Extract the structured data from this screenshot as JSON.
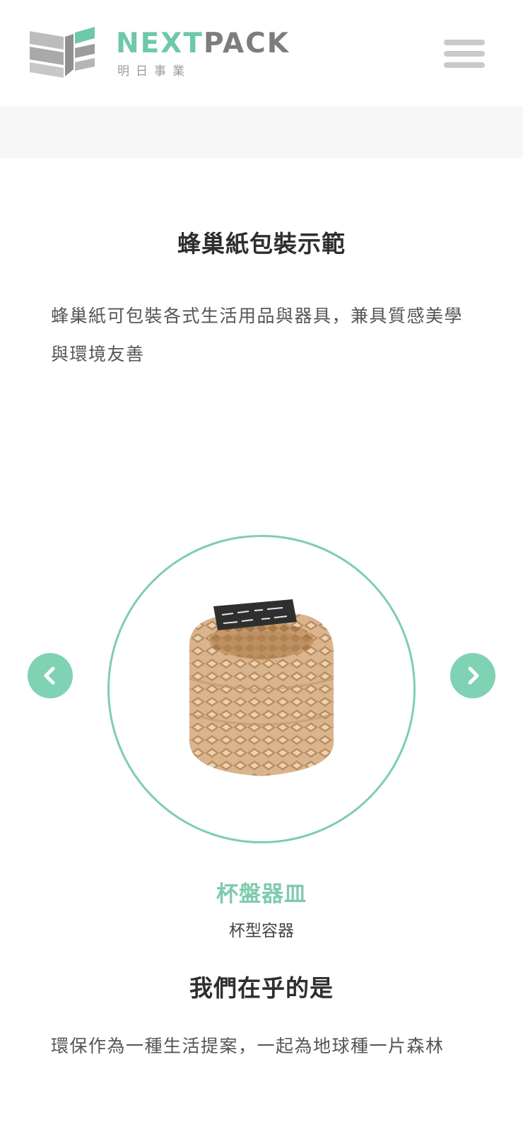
{
  "header": {
    "brand_primary": "NEXT",
    "brand_secondary": "PACK",
    "brand_sub": "明日事業",
    "menu_icon": "hamburger-icon"
  },
  "demo_section": {
    "title": "蜂巢紙包裝示範",
    "description": "蜂巢紙可包裝各式生活用品與器具，兼具質感美學與環境友善"
  },
  "carousel": {
    "prev_icon": "chevron-left-icon",
    "next_icon": "chevron-right-icon",
    "slide": {
      "title": "杯盤器皿",
      "subtitle": "杯型容器",
      "image_label": "honeycomb-paper-cup-wrap-image"
    }
  },
  "care_section": {
    "title": "我們在乎的是",
    "description": "環保作為一種生活提案，一起為地球種一片森林"
  },
  "colors": {
    "accent": "#7fd2b3",
    "brand_green": "#6fc8a8",
    "brand_grey": "#7d7d7d",
    "band": "#f7f7f7"
  }
}
